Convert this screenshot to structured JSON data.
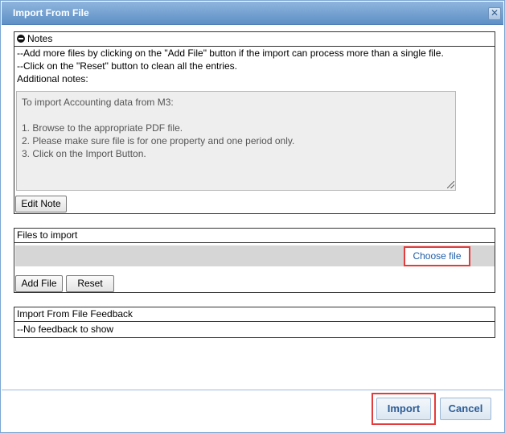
{
  "dialog": {
    "title": "Import From File",
    "close_glyph": "✕"
  },
  "notes": {
    "header": "Notes",
    "lines": [
      "--Add more files by clicking on the \"Add File\" button if the import can process more than a single file.",
      "--Click on the \"Reset\" button to clean all the entries.",
      "Additional notes:"
    ],
    "text": "To import Accounting data from M3:\n\n1. Browse to the appropriate PDF file.\n2. Please make sure file is for one property and one period only.\n3. Click on the Import Button.",
    "edit_label": "Edit Note"
  },
  "files": {
    "header": "Files to import",
    "choose_label": "Choose file",
    "add_label": "Add File",
    "reset_label": "Reset"
  },
  "feedback": {
    "header": "Import From File Feedback",
    "message": "--No feedback to show"
  },
  "footer": {
    "import_label": "Import",
    "cancel_label": "Cancel"
  },
  "colors": {
    "titlebar": "#6f9bd0",
    "highlight": "#e43c3c",
    "button_text": "#2c5c95"
  }
}
